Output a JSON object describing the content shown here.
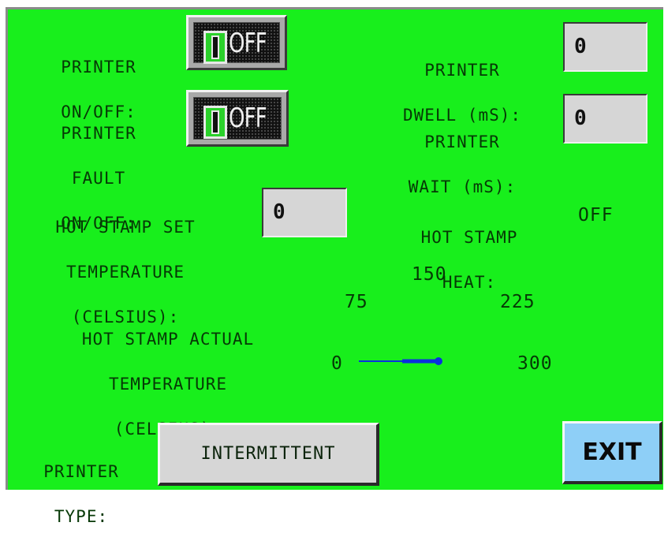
{
  "printer_onoff": {
    "label_line1": "PRINTER",
    "label_line2": "ON/OFF:",
    "toggle_state": "OFF"
  },
  "printer_fault": {
    "label_line1": "PRINTER",
    "label_line2": "FAULT",
    "label_line3": "ON/OFF:",
    "toggle_state": "OFF"
  },
  "printer_dwell": {
    "label_line1": "PRINTER",
    "label_line2": "DWELL (mS):",
    "value": "0"
  },
  "printer_wait": {
    "label_line1": "PRINTER",
    "label_line2": "WAIT (mS):",
    "value": "0"
  },
  "set_temp": {
    "label_line1": "HOT STAMP SET",
    "label_line2": "TEMPERATURE",
    "label_line3": "(CELSIUS):",
    "value": "0"
  },
  "heat": {
    "label_line1": "HOT STAMP",
    "label_line2": "HEAT:",
    "value": "OFF"
  },
  "actual_temp": {
    "label_line1": "HOT STAMP ACTUAL",
    "label_line2": "TEMPERATURE",
    "label_line3": "(CELSIUS):"
  },
  "gauge": {
    "ticks": [
      "0",
      "75",
      "150",
      "225",
      "300"
    ],
    "reading": 0,
    "min": 0,
    "max": 300,
    "needle_color": "#0a2fe0"
  },
  "printer_type": {
    "label_line1": "PRINTER",
    "label_line2": "TYPE:",
    "value": "INTERMITTENT"
  },
  "exit_button": {
    "label": "EXIT"
  },
  "colors": {
    "background": "#18ef1c",
    "exit": "#8ecff7",
    "field": "#d6d6d6"
  }
}
